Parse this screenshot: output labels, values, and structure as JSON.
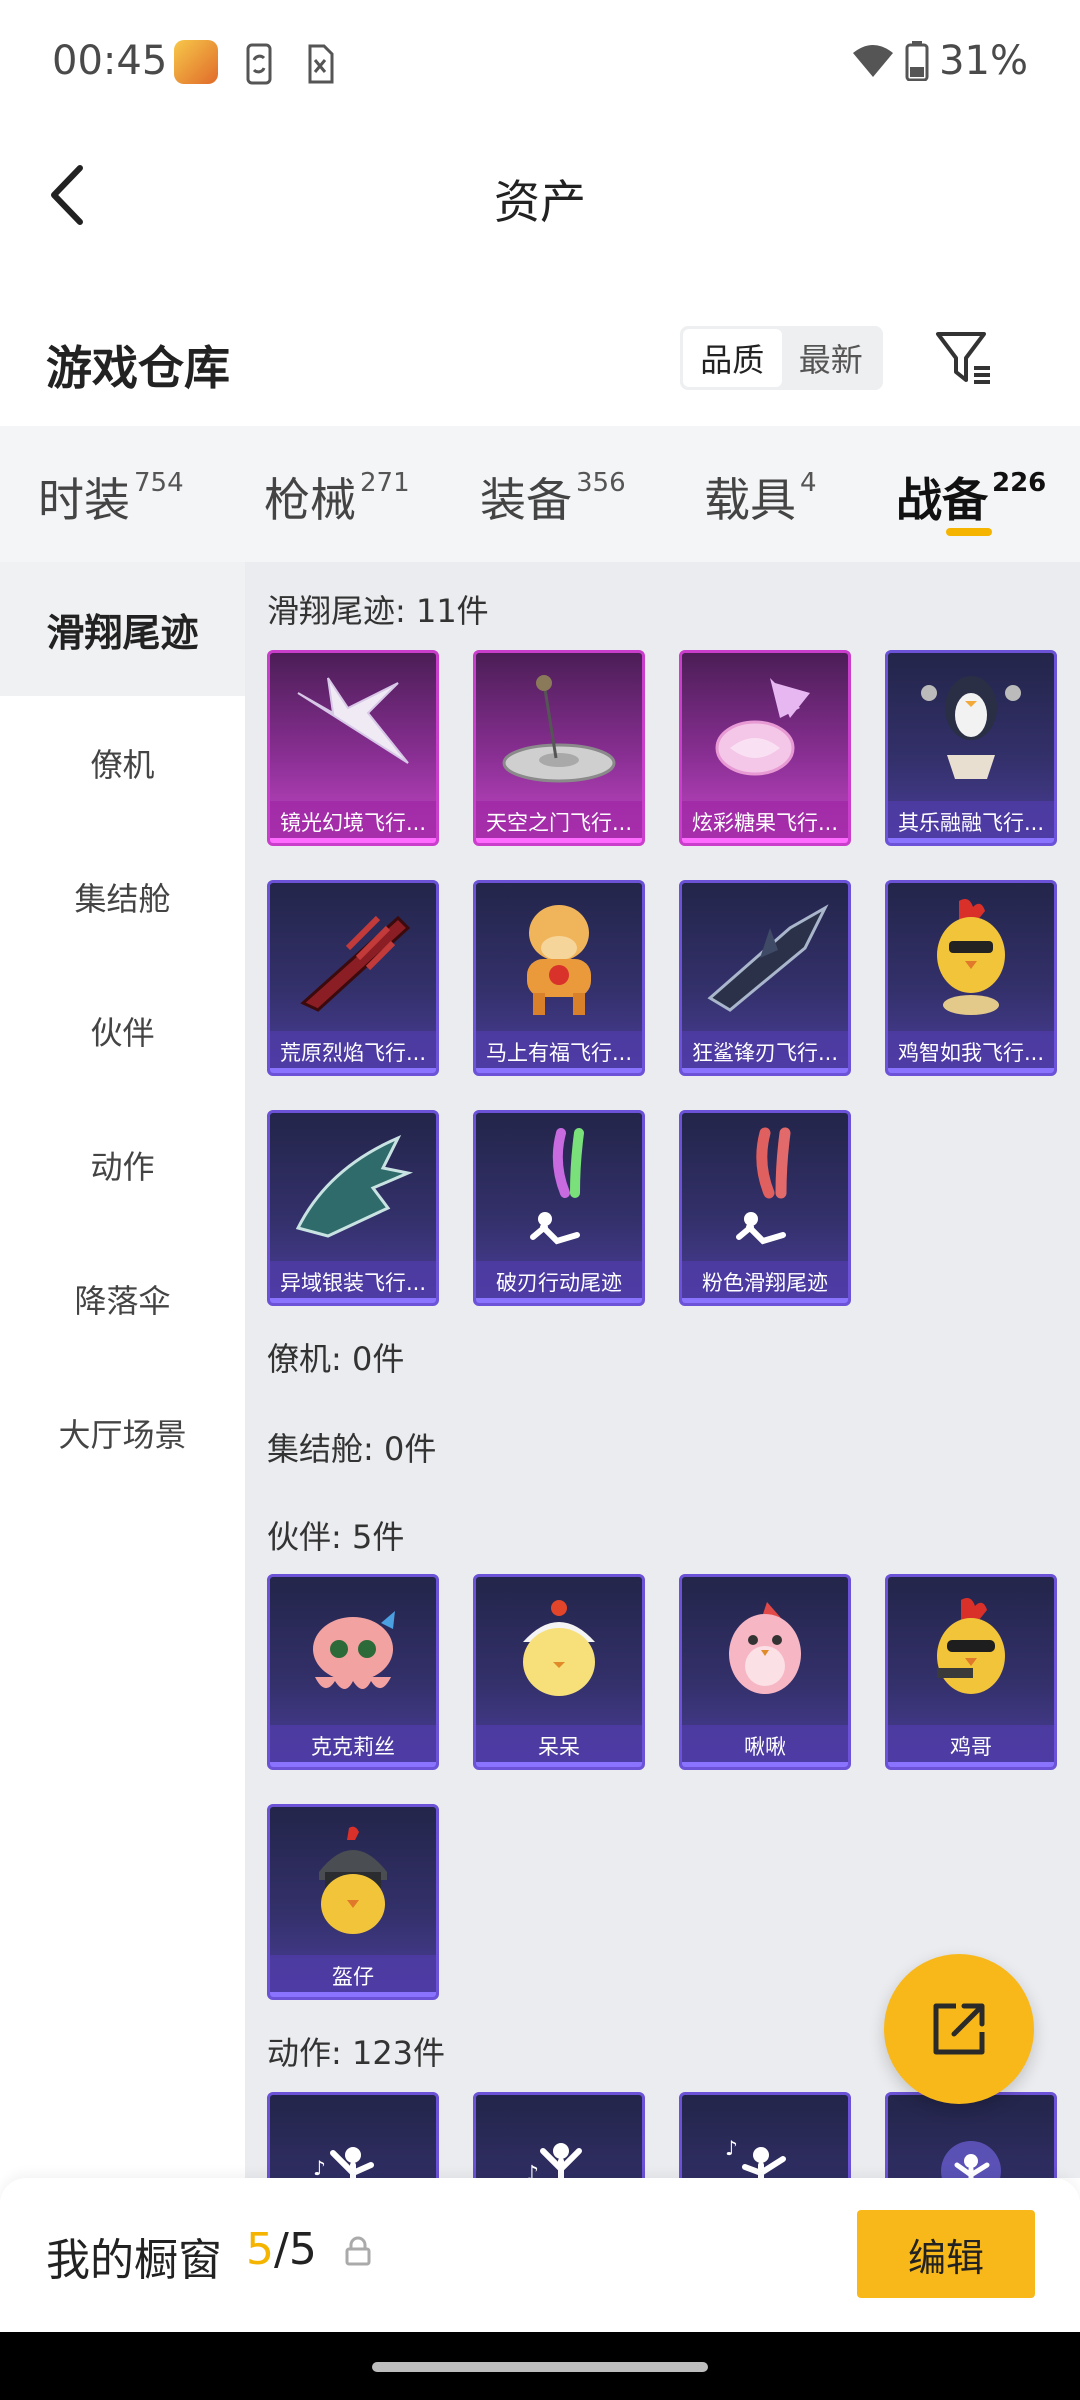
{
  "status_bar": {
    "time": "00:45",
    "battery": "31%"
  },
  "header": {
    "title": "资产"
  },
  "warehouse": {
    "title": "游戏仓库",
    "sort_quality": "品质",
    "sort_latest": "最新"
  },
  "tabs": [
    {
      "label": "时装",
      "count": "754"
    },
    {
      "label": "枪械",
      "count": "271"
    },
    {
      "label": "装备",
      "count": "356"
    },
    {
      "label": "载具",
      "count": "4"
    },
    {
      "label": "战备",
      "count": "226"
    }
  ],
  "sidebar": {
    "items": [
      "滑翔尾迹",
      "僚机",
      "集结舱",
      "伙伴",
      "动作",
      "降落伞",
      "大厅场景"
    ]
  },
  "sections": {
    "trails": {
      "title": "滑翔尾迹: 11件",
      "items": [
        "镜光幻境飞行...",
        "天空之门飞行...",
        "炫彩糖果飞行...",
        "其乐融融飞行...",
        "荒原烈焰飞行...",
        "马上有福飞行...",
        "狂鲨锋刃飞行...",
        "鸡智如我飞行...",
        "异域银装飞行...",
        "破刃行动尾迹",
        "粉色滑翔尾迹"
      ]
    },
    "wingman": {
      "title": "僚机: 0件"
    },
    "capsule": {
      "title": "集结舱: 0件"
    },
    "partners": {
      "title": "伙伴: 5件",
      "items": [
        "克克莉丝",
        "呆呆",
        "啾啾",
        "鸡哥",
        "盔仔"
      ]
    },
    "emotes": {
      "title": "动作: 123件"
    }
  },
  "bottom": {
    "showcase_label": "我的橱窗",
    "showcase_current": "5",
    "showcase_total": "/5",
    "edit_label": "编辑"
  },
  "colors": {
    "accent": "#f8b81a",
    "card_border": "#6b52d6",
    "card_border_legendary": "#c93fcb"
  }
}
